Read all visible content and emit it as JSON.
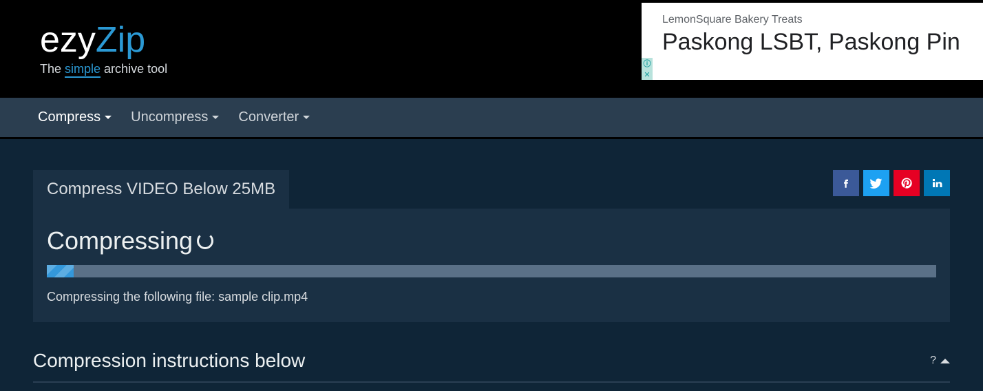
{
  "header": {
    "logo_part1": "ezy",
    "logo_part2": "Zip",
    "tagline_prefix": "The ",
    "tagline_simple": "simple",
    "tagline_suffix": " archive tool"
  },
  "ad": {
    "subtitle": "LemonSquare Bakery Treats",
    "title": "Paskong LSBT, Paskong Pin"
  },
  "nav": {
    "items": [
      {
        "label": "Compress",
        "active": true
      },
      {
        "label": "Uncompress",
        "active": false
      },
      {
        "label": "Converter",
        "active": false
      }
    ]
  },
  "tab": {
    "title": "Compress VIDEO Below 25MB"
  },
  "progress": {
    "title": "Compressing",
    "percent": 3,
    "status": "Compressing the following file: sample clip.mp4"
  },
  "instructions": {
    "title": "Compression instructions below",
    "toggle_label": "?"
  },
  "colors": {
    "accent": "#2b99d4",
    "navbg": "#2b3e50",
    "panelbg": "#1a3044",
    "bodybg": "#0f2537"
  }
}
